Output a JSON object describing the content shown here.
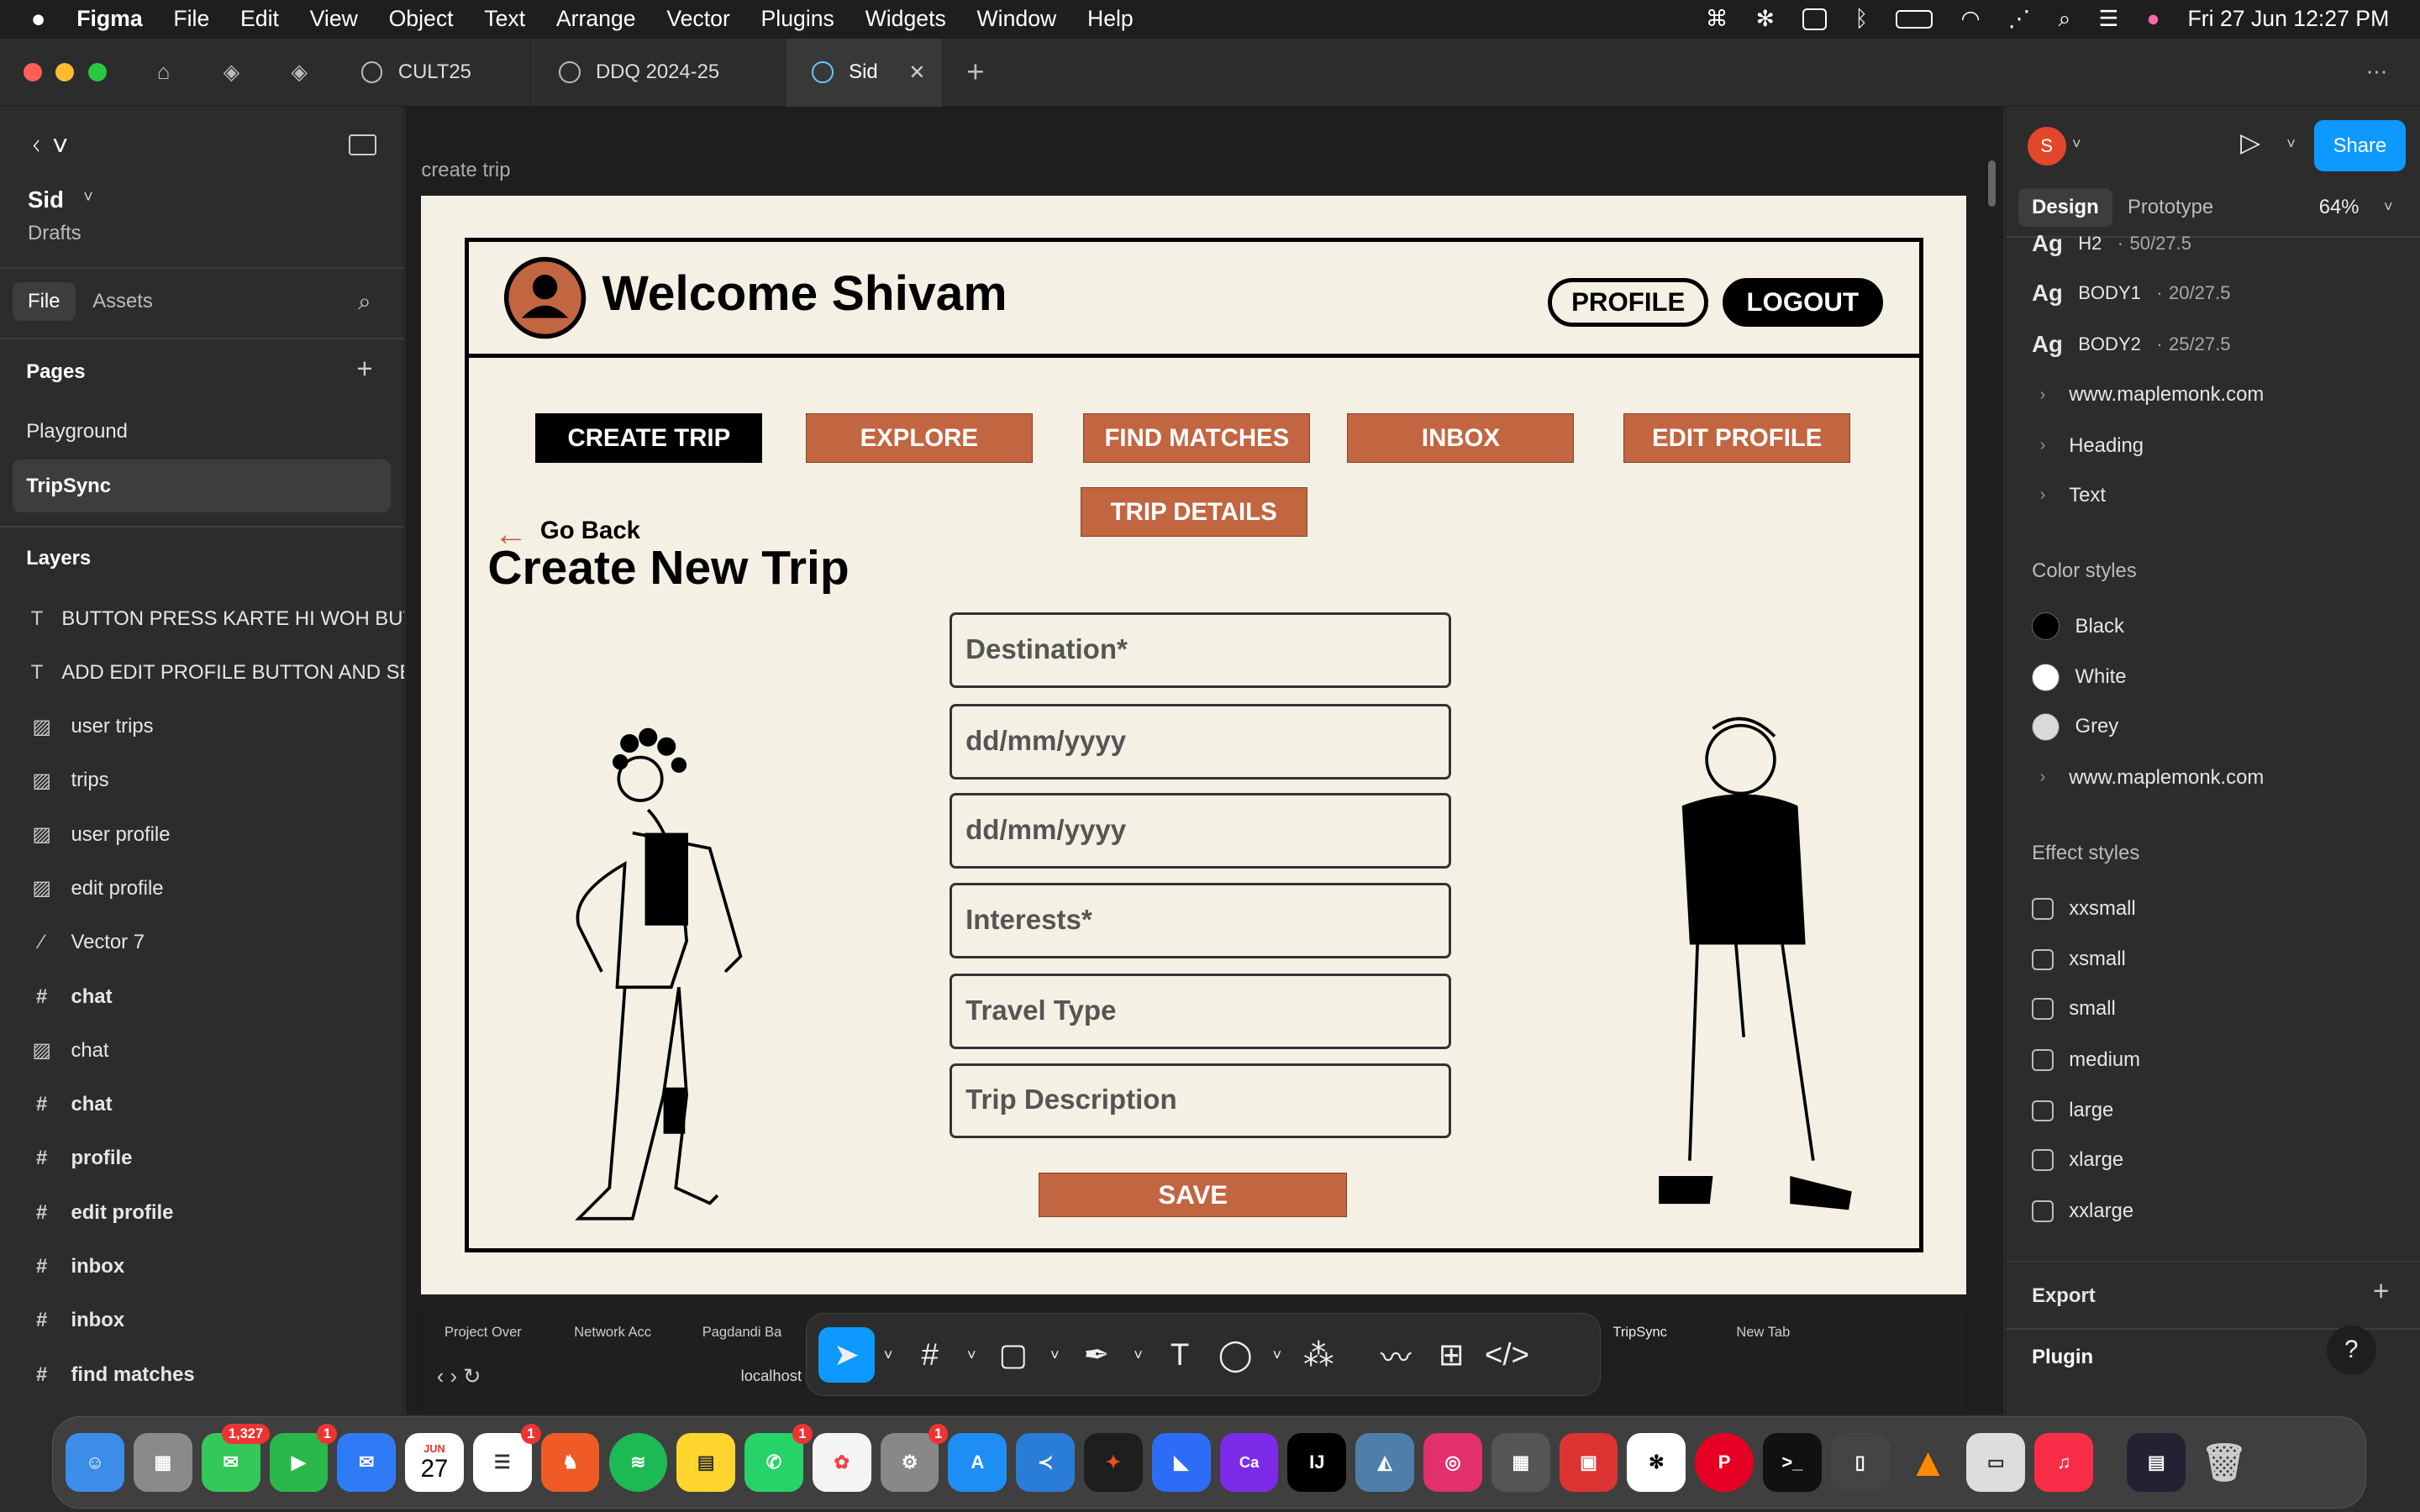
{
  "menubar": {
    "app": "Figma",
    "items": [
      "File",
      "Edit",
      "View",
      "Object",
      "Text",
      "Arrange",
      "Vector",
      "Plugins",
      "Widgets",
      "Window",
      "Help"
    ],
    "datetime": "Fri 27 Jun  12:27 PM"
  },
  "tabs": [
    {
      "label": "CULT25"
    },
    {
      "label": "DDQ 2024-25"
    },
    {
      "label": "Sid"
    }
  ],
  "left": {
    "file_name": "Sid",
    "file_location": "Drafts",
    "tabs": {
      "file": "File",
      "assets": "Assets"
    },
    "pages_title": "Pages",
    "pages": [
      "Playground",
      "TripSync"
    ],
    "layers_title": "Layers",
    "layers": [
      {
        "icon": "T",
        "label": "BUTTON PRESS KARTE HI WOH BUTTON"
      },
      {
        "icon": "T",
        "label": "ADD EDIT PROFILE BUTTON AND SEE"
      },
      {
        "icon": "img",
        "label": "user trips"
      },
      {
        "icon": "img",
        "label": "trips"
      },
      {
        "icon": "img",
        "label": "user profile"
      },
      {
        "icon": "img",
        "label": "edit profile"
      },
      {
        "icon": "vec",
        "label": "Vector 7"
      },
      {
        "icon": "#",
        "label": "chat"
      },
      {
        "icon": "img",
        "label": "chat"
      },
      {
        "icon": "#",
        "label": "chat"
      },
      {
        "icon": "#",
        "label": "profile"
      },
      {
        "icon": "#",
        "label": "edit profile"
      },
      {
        "icon": "#",
        "label": "inbox"
      },
      {
        "icon": "#",
        "label": "inbox"
      },
      {
        "icon": "#",
        "label": "find matches"
      }
    ]
  },
  "canvas": {
    "frame_label": "create trip",
    "welcome": "Welcome Shivam",
    "profile_btn": "PROFILE",
    "logout_btn": "LOGOUT",
    "nav": [
      "CREATE TRIP",
      "EXPLORE",
      "FIND MATCHES",
      "INBOX",
      "EDIT PROFILE",
      "TRIP DETAILS"
    ],
    "go_back": "Go Back",
    "heading": "Create New Trip",
    "fields": [
      "Destination*",
      "dd/mm/yyyy",
      "dd/mm/yyyy",
      "Interests*",
      "Travel Type",
      "Trip Description"
    ],
    "save": "SAVE"
  },
  "browser": {
    "tabs": [
      "Project Over",
      "Network Acc",
      "Pagdandi Ba",
      "TripSync",
      "New Tab"
    ],
    "url": "localhost"
  },
  "right": {
    "avatar_letter": "S",
    "share": "Share",
    "tabs": {
      "design": "Design",
      "prototype": "Prototype"
    },
    "zoom": "64%",
    "text_styles": [
      {
        "name": "H2",
        "spec": "50/27.5"
      },
      {
        "name": "BODY1",
        "spec": "20/27.5"
      },
      {
        "name": "BODY2",
        "spec": "25/27.5"
      }
    ],
    "text_groups": [
      "www.maplemonk.com",
      "Heading",
      "Text"
    ],
    "color_title": "Color styles",
    "colors": [
      {
        "name": "Black",
        "hex": "#000000"
      },
      {
        "name": "White",
        "hex": "#ffffff"
      },
      {
        "name": "Grey",
        "hex": "#d9d9d9"
      }
    ],
    "color_group": "www.maplemonk.com",
    "effect_title": "Effect styles",
    "effects": [
      "xxsmall",
      "xsmall",
      "small",
      "medium",
      "large",
      "xlarge",
      "xxlarge"
    ],
    "export": "Export",
    "plugin": "Plugin"
  },
  "dock": {
    "badges": {
      "messages": "1,327",
      "facetime": "1",
      "reminders": "1",
      "whatsapp": "1",
      "settings": "1"
    },
    "calendar_month": "JUN",
    "calendar_day": "27"
  },
  "colors": {
    "accent": "#c26541",
    "figma_blue": "#0d99ff",
    "frame_bg": "#f4f1e4"
  }
}
